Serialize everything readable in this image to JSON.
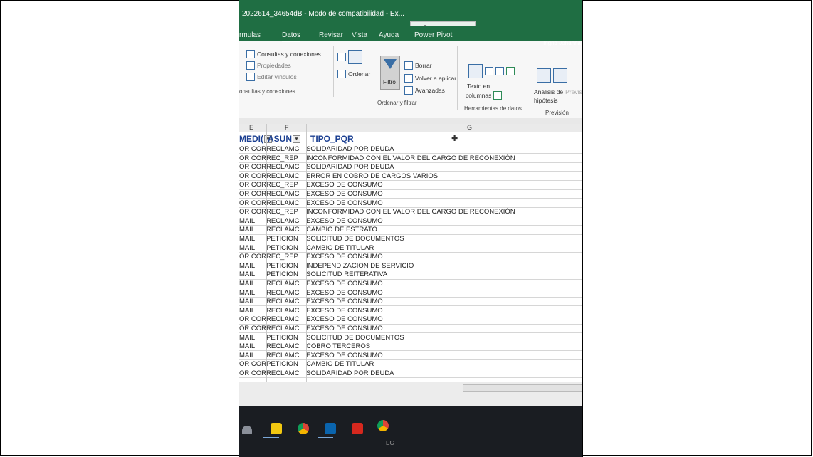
{
  "window": {
    "title": "2022614_34654dB - Modo de compatibilidad - Ex...",
    "search_placeholder": "Buscar",
    "user": "Ingrid Johanna"
  },
  "ribbon_tabs": [
    "rmulas",
    "Datos",
    "Revisar",
    "Vista",
    "Ayuda",
    "Power Pivot"
  ],
  "ribbon": {
    "consultas_conexiones": "Consultas y conexiones",
    "propiedades": "Propiedades",
    "editar_vinculos": "Editar vínculos",
    "group_consultas": "onsultas y conexiones",
    "ordenar": "Ordenar",
    "filtro": "Filtro",
    "borrar": "Borrar",
    "volver_aplicar": "Volver a aplicar",
    "avanzadas": "Avanzadas",
    "group_ordenar": "Ordenar y filtrar",
    "texto_en": "Texto en",
    "columnas": "columnas",
    "group_herramientas": "Herramientas de datos",
    "analisis": "Análisis de",
    "hipotesis": "hipótesis",
    "prevision_btn": "Previsión",
    "group_prevision": "Previsión"
  },
  "columns": {
    "letters": [
      "E",
      "F",
      "G"
    ],
    "headers": [
      "MEDI(",
      "ASUN",
      "TIPO_PQR"
    ]
  },
  "rows": [
    [
      "OR COR",
      "RECLAMC",
      "SOLIDARIDAD POR DEUDA"
    ],
    [
      "OR COR",
      "REC_REP",
      "INCONFORMIDAD CON EL VALOR DEL CARGO DE RECONEXIÓN"
    ],
    [
      "OR COR",
      "RECLAMC",
      "SOLIDARIDAD POR DEUDA"
    ],
    [
      "OR COR",
      "RECLAMC",
      "ERROR EN COBRO DE CARGOS VARIOS"
    ],
    [
      "OR COR",
      "REC_REP",
      "EXCESO DE CONSUMO"
    ],
    [
      "OR COR",
      "RECLAMC",
      "EXCESO DE CONSUMO"
    ],
    [
      "OR COR",
      "RECLAMC",
      "EXCESO DE CONSUMO"
    ],
    [
      "OR COR",
      "REC_REP",
      "INCONFORMIDAD CON EL VALOR DEL CARGO DE RECONEXIÓN"
    ],
    [
      "MAIL",
      "RECLAMC",
      "EXCESO DE CONSUMO"
    ],
    [
      "MAIL",
      "RECLAMC",
      "CAMBIO DE ESTRATO"
    ],
    [
      "MAIL",
      "PETICION",
      "SOLICITUD DE DOCUMENTOS"
    ],
    [
      "MAIL",
      "PETICION",
      "CAMBIO DE TITULAR"
    ],
    [
      "OR COR",
      "REC_REP",
      "EXCESO DE CONSUMO"
    ],
    [
      "MAIL",
      "PETICION",
      "INDEPENDIZACION DE SERVICIO"
    ],
    [
      "MAIL",
      "PETICION",
      "SOLICITUD REITERATIVA"
    ],
    [
      "MAIL",
      "RECLAMC",
      "EXCESO DE CONSUMO"
    ],
    [
      "MAIL",
      "RECLAMC",
      "EXCESO DE CONSUMO"
    ],
    [
      "MAIL",
      "RECLAMC",
      "EXCESO DE CONSUMO"
    ],
    [
      "MAIL",
      "RECLAMC",
      "EXCESO DE CONSUMO"
    ],
    [
      "OR COR",
      "RECLAMC",
      "EXCESO DE CONSUMO"
    ],
    [
      "OR COR",
      "RECLAMC",
      "EXCESO DE CONSUMO"
    ],
    [
      "MAIL",
      "PETICION",
      "SOLICITUD DE DOCUMENTOS"
    ],
    [
      "MAIL",
      "RECLAMC",
      "COBRO TERCEROS"
    ],
    [
      "MAIL",
      "RECLAMC",
      "EXCESO DE CONSUMO"
    ],
    [
      "OR COR",
      "PETICION",
      "CAMBIO DE TITULAR"
    ],
    [
      "OR COR",
      "RECLAMC",
      "SOLIDARIDAD POR DEUDA"
    ]
  ],
  "taskbar": {
    "brand": "LG",
    "icons": [
      "wifi-icon",
      "sticky-notes-icon",
      "chrome-icon",
      "outlook-icon",
      "acrobat-icon",
      "chrome-icon"
    ]
  }
}
